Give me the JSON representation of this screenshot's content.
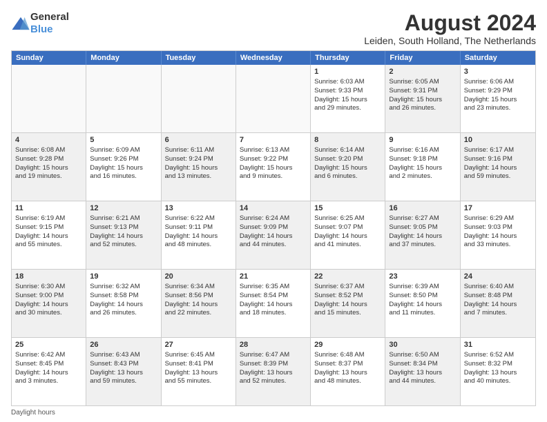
{
  "header": {
    "logo_general": "General",
    "logo_blue": "Blue",
    "main_title": "August 2024",
    "subtitle": "Leiden, South Holland, The Netherlands"
  },
  "calendar": {
    "days_of_week": [
      "Sunday",
      "Monday",
      "Tuesday",
      "Wednesday",
      "Thursday",
      "Friday",
      "Saturday"
    ],
    "footer_note": "Daylight hours",
    "rows": [
      [
        {
          "day": "",
          "empty": true
        },
        {
          "day": "",
          "empty": true
        },
        {
          "day": "",
          "empty": true
        },
        {
          "day": "",
          "empty": true
        },
        {
          "day": "1",
          "line1": "Sunrise: 6:03 AM",
          "line2": "Sunset: 9:33 PM",
          "line3": "Daylight: 15 hours",
          "line4": "and 29 minutes.",
          "shaded": false
        },
        {
          "day": "2",
          "line1": "Sunrise: 6:05 AM",
          "line2": "Sunset: 9:31 PM",
          "line3": "Daylight: 15 hours",
          "line4": "and 26 minutes.",
          "shaded": true
        },
        {
          "day": "3",
          "line1": "Sunrise: 6:06 AM",
          "line2": "Sunset: 9:29 PM",
          "line3": "Daylight: 15 hours",
          "line4": "and 23 minutes.",
          "shaded": false
        }
      ],
      [
        {
          "day": "4",
          "line1": "Sunrise: 6:08 AM",
          "line2": "Sunset: 9:28 PM",
          "line3": "Daylight: 15 hours",
          "line4": "and 19 minutes.",
          "shaded": true
        },
        {
          "day": "5",
          "line1": "Sunrise: 6:09 AM",
          "line2": "Sunset: 9:26 PM",
          "line3": "Daylight: 15 hours",
          "line4": "and 16 minutes.",
          "shaded": false
        },
        {
          "day": "6",
          "line1": "Sunrise: 6:11 AM",
          "line2": "Sunset: 9:24 PM",
          "line3": "Daylight: 15 hours",
          "line4": "and 13 minutes.",
          "shaded": true
        },
        {
          "day": "7",
          "line1": "Sunrise: 6:13 AM",
          "line2": "Sunset: 9:22 PM",
          "line3": "Daylight: 15 hours",
          "line4": "and 9 minutes.",
          "shaded": false
        },
        {
          "day": "8",
          "line1": "Sunrise: 6:14 AM",
          "line2": "Sunset: 9:20 PM",
          "line3": "Daylight: 15 hours",
          "line4": "and 6 minutes.",
          "shaded": true
        },
        {
          "day": "9",
          "line1": "Sunrise: 6:16 AM",
          "line2": "Sunset: 9:18 PM",
          "line3": "Daylight: 15 hours",
          "line4": "and 2 minutes.",
          "shaded": false
        },
        {
          "day": "10",
          "line1": "Sunrise: 6:17 AM",
          "line2": "Sunset: 9:16 PM",
          "line3": "Daylight: 14 hours",
          "line4": "and 59 minutes.",
          "shaded": true
        }
      ],
      [
        {
          "day": "11",
          "line1": "Sunrise: 6:19 AM",
          "line2": "Sunset: 9:15 PM",
          "line3": "Daylight: 14 hours",
          "line4": "and 55 minutes.",
          "shaded": false
        },
        {
          "day": "12",
          "line1": "Sunrise: 6:21 AM",
          "line2": "Sunset: 9:13 PM",
          "line3": "Daylight: 14 hours",
          "line4": "and 52 minutes.",
          "shaded": true
        },
        {
          "day": "13",
          "line1": "Sunrise: 6:22 AM",
          "line2": "Sunset: 9:11 PM",
          "line3": "Daylight: 14 hours",
          "line4": "and 48 minutes.",
          "shaded": false
        },
        {
          "day": "14",
          "line1": "Sunrise: 6:24 AM",
          "line2": "Sunset: 9:09 PM",
          "line3": "Daylight: 14 hours",
          "line4": "and 44 minutes.",
          "shaded": true
        },
        {
          "day": "15",
          "line1": "Sunrise: 6:25 AM",
          "line2": "Sunset: 9:07 PM",
          "line3": "Daylight: 14 hours",
          "line4": "and 41 minutes.",
          "shaded": false
        },
        {
          "day": "16",
          "line1": "Sunrise: 6:27 AM",
          "line2": "Sunset: 9:05 PM",
          "line3": "Daylight: 14 hours",
          "line4": "and 37 minutes.",
          "shaded": true
        },
        {
          "day": "17",
          "line1": "Sunrise: 6:29 AM",
          "line2": "Sunset: 9:03 PM",
          "line3": "Daylight: 14 hours",
          "line4": "and 33 minutes.",
          "shaded": false
        }
      ],
      [
        {
          "day": "18",
          "line1": "Sunrise: 6:30 AM",
          "line2": "Sunset: 9:00 PM",
          "line3": "Daylight: 14 hours",
          "line4": "and 30 minutes.",
          "shaded": true
        },
        {
          "day": "19",
          "line1": "Sunrise: 6:32 AM",
          "line2": "Sunset: 8:58 PM",
          "line3": "Daylight: 14 hours",
          "line4": "and 26 minutes.",
          "shaded": false
        },
        {
          "day": "20",
          "line1": "Sunrise: 6:34 AM",
          "line2": "Sunset: 8:56 PM",
          "line3": "Daylight: 14 hours",
          "line4": "and 22 minutes.",
          "shaded": true
        },
        {
          "day": "21",
          "line1": "Sunrise: 6:35 AM",
          "line2": "Sunset: 8:54 PM",
          "line3": "Daylight: 14 hours",
          "line4": "and 18 minutes.",
          "shaded": false
        },
        {
          "day": "22",
          "line1": "Sunrise: 6:37 AM",
          "line2": "Sunset: 8:52 PM",
          "line3": "Daylight: 14 hours",
          "line4": "and 15 minutes.",
          "shaded": true
        },
        {
          "day": "23",
          "line1": "Sunrise: 6:39 AM",
          "line2": "Sunset: 8:50 PM",
          "line3": "Daylight: 14 hours",
          "line4": "and 11 minutes.",
          "shaded": false
        },
        {
          "day": "24",
          "line1": "Sunrise: 6:40 AM",
          "line2": "Sunset: 8:48 PM",
          "line3": "Daylight: 14 hours",
          "line4": "and 7 minutes.",
          "shaded": true
        }
      ],
      [
        {
          "day": "25",
          "line1": "Sunrise: 6:42 AM",
          "line2": "Sunset: 8:45 PM",
          "line3": "Daylight: 14 hours",
          "line4": "and 3 minutes.",
          "shaded": false
        },
        {
          "day": "26",
          "line1": "Sunrise: 6:43 AM",
          "line2": "Sunset: 8:43 PM",
          "line3": "Daylight: 13 hours",
          "line4": "and 59 minutes.",
          "shaded": true
        },
        {
          "day": "27",
          "line1": "Sunrise: 6:45 AM",
          "line2": "Sunset: 8:41 PM",
          "line3": "Daylight: 13 hours",
          "line4": "and 55 minutes.",
          "shaded": false
        },
        {
          "day": "28",
          "line1": "Sunrise: 6:47 AM",
          "line2": "Sunset: 8:39 PM",
          "line3": "Daylight: 13 hours",
          "line4": "and 52 minutes.",
          "shaded": true
        },
        {
          "day": "29",
          "line1": "Sunrise: 6:48 AM",
          "line2": "Sunset: 8:37 PM",
          "line3": "Daylight: 13 hours",
          "line4": "and 48 minutes.",
          "shaded": false
        },
        {
          "day": "30",
          "line1": "Sunrise: 6:50 AM",
          "line2": "Sunset: 8:34 PM",
          "line3": "Daylight: 13 hours",
          "line4": "and 44 minutes.",
          "shaded": true
        },
        {
          "day": "31",
          "line1": "Sunrise: 6:52 AM",
          "line2": "Sunset: 8:32 PM",
          "line3": "Daylight: 13 hours",
          "line4": "and 40 minutes.",
          "shaded": false
        }
      ]
    ]
  }
}
